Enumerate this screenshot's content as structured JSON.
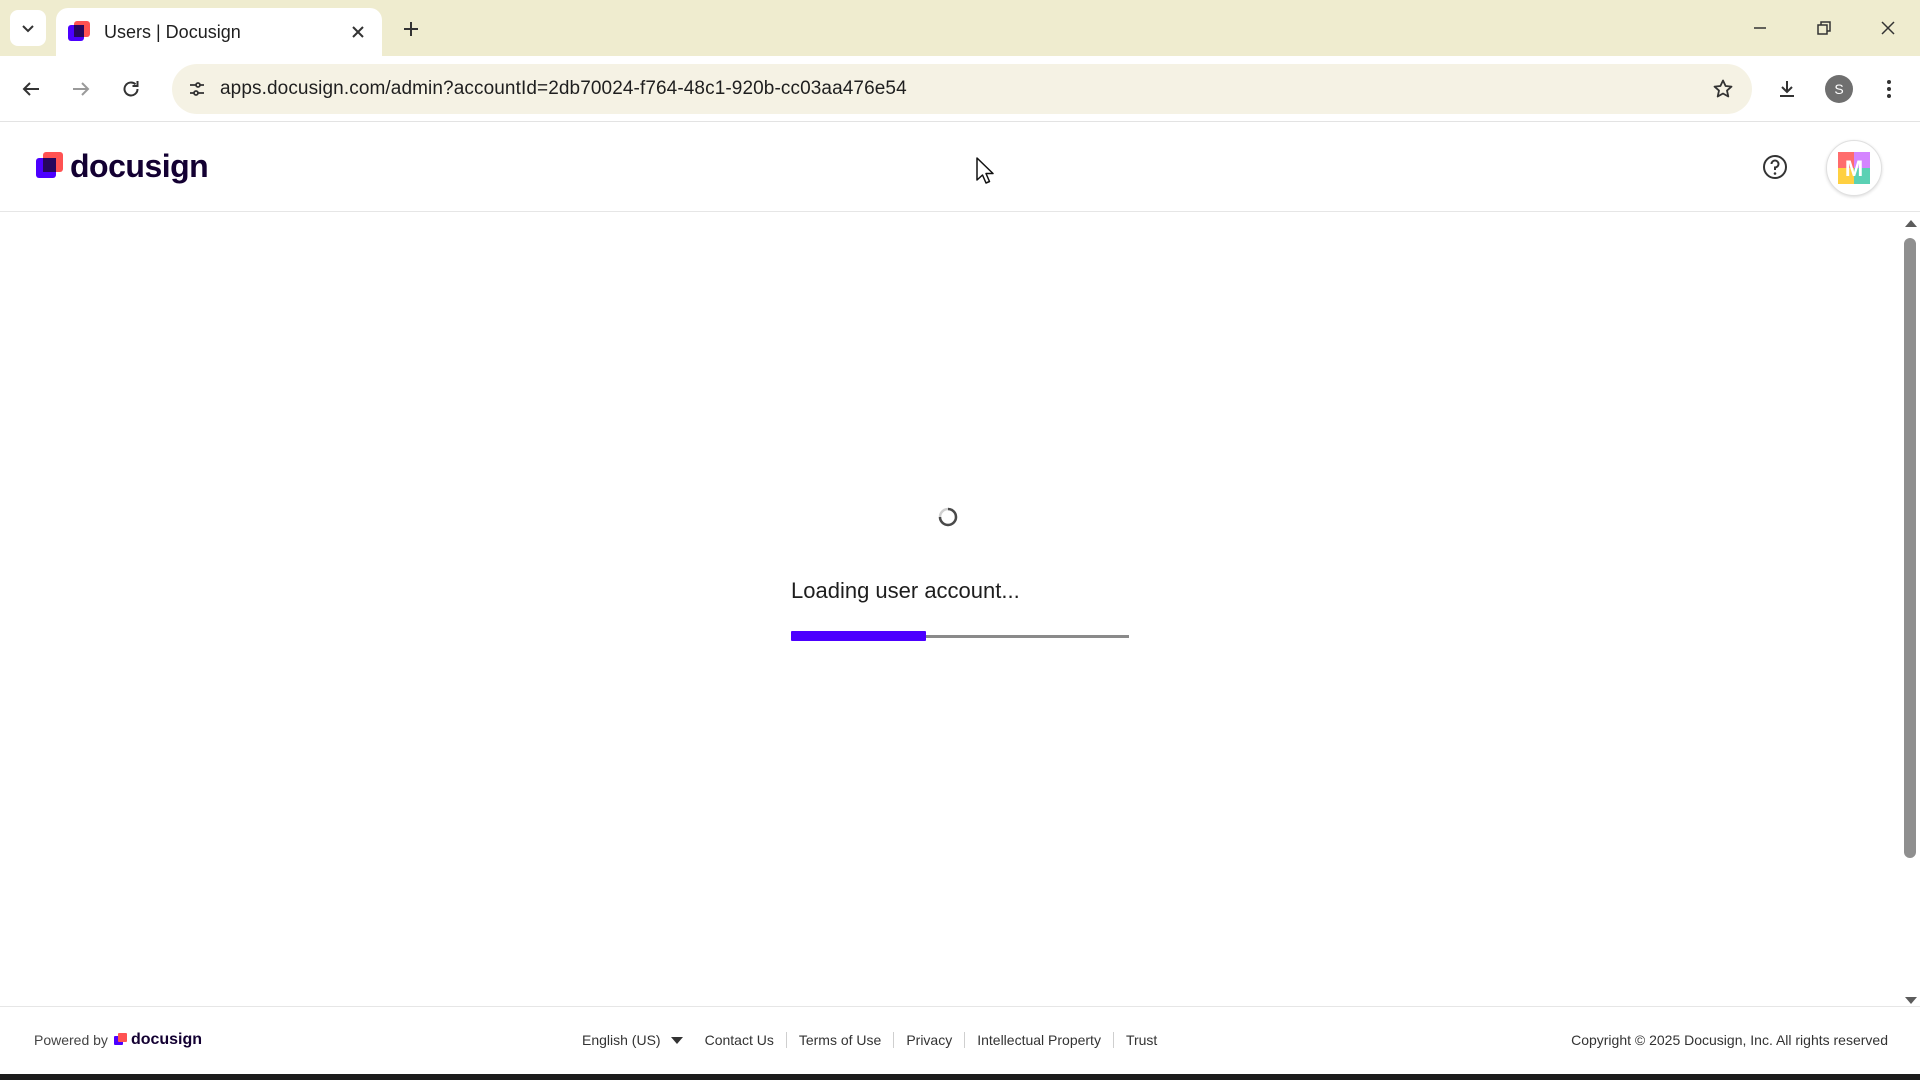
{
  "browser": {
    "tab_title": "Users | Docusign",
    "url": "apps.docusign.com/admin?accountId=2db70024-f764-48c1-920b-cc03aa476e54",
    "profile_initial": "S"
  },
  "header": {
    "logo_text": "docusign",
    "avatar_initial": "M"
  },
  "main": {
    "loading_text": "Loading user account...",
    "progress": 0.4
  },
  "footer": {
    "powered_by": "Powered by",
    "powered_logo": "docusign",
    "language": "English (US)",
    "links": [
      "Contact Us",
      "Terms of Use",
      "Privacy",
      "Intellectual Property",
      "Trust"
    ],
    "copyright": "Copyright © 2025 Docusign, Inc. All rights reserved"
  },
  "colors": {
    "brand_primary": "#4c00ff",
    "brand_accent": "#ff5252",
    "brand_dark": "#26065d",
    "tabstrip": "#efeccf"
  },
  "icons": {
    "tab_search": "chevron-down-icon",
    "tab_close": "close-icon",
    "new_tab": "plus-icon",
    "back": "arrow-left-icon",
    "forward": "arrow-right-icon",
    "reload": "reload-icon",
    "site_info": "tune-icon",
    "bookmark": "star-icon",
    "download": "download-icon",
    "menu": "more-vertical-icon",
    "help": "help-circle-icon",
    "loading": "spinner-icon"
  }
}
